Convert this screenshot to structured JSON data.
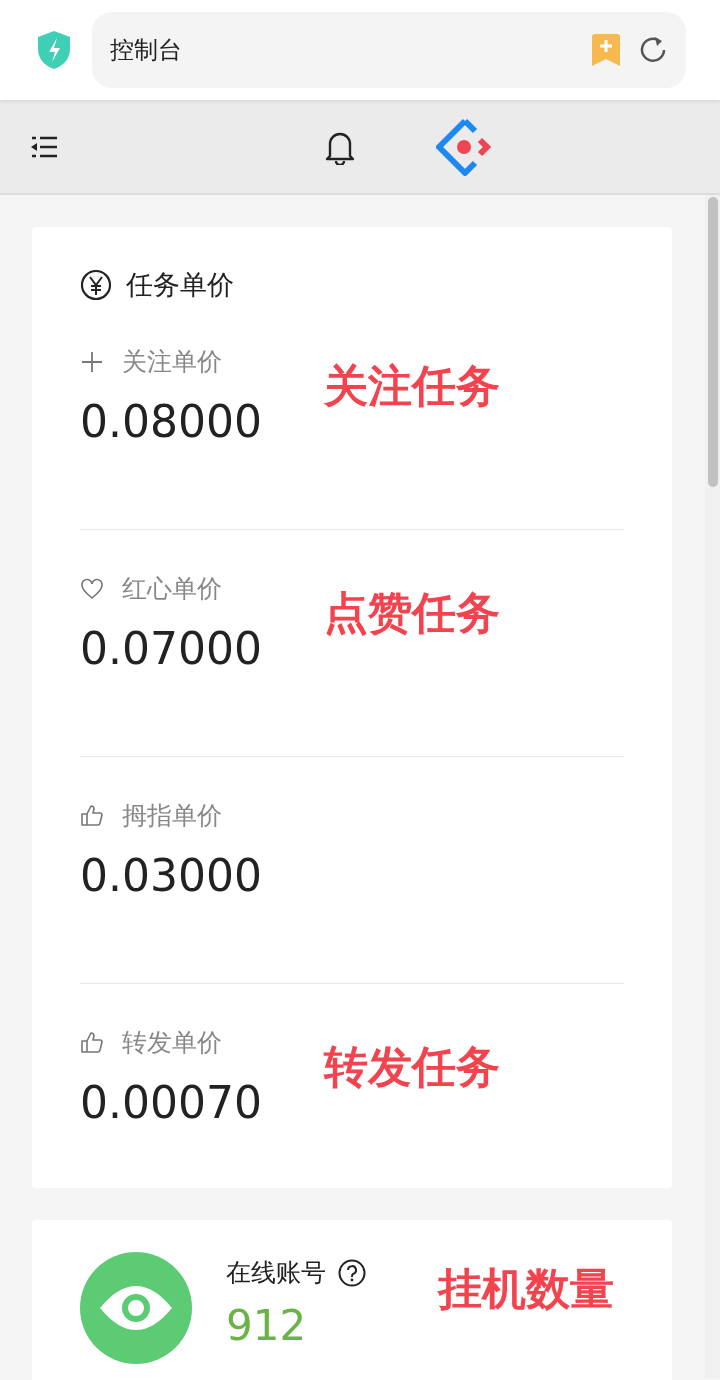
{
  "browser": {
    "address": "控制台"
  },
  "price_card": {
    "title": "任务单价",
    "items": [
      {
        "kind": "plus",
        "label": "关注单价",
        "value": "0.08000",
        "annotation": "关注任务"
      },
      {
        "kind": "heart",
        "label": "红心单价",
        "value": "0.07000",
        "annotation": "点赞任务"
      },
      {
        "kind": "thumb",
        "label": "拇指单价",
        "value": "0.03000"
      },
      {
        "kind": "thumb",
        "label": "转发单价",
        "value": "0.00070",
        "annotation": "转发任务"
      }
    ]
  },
  "online_card": {
    "label": "在线账号",
    "value": "912",
    "annotation": "挂机数量"
  }
}
